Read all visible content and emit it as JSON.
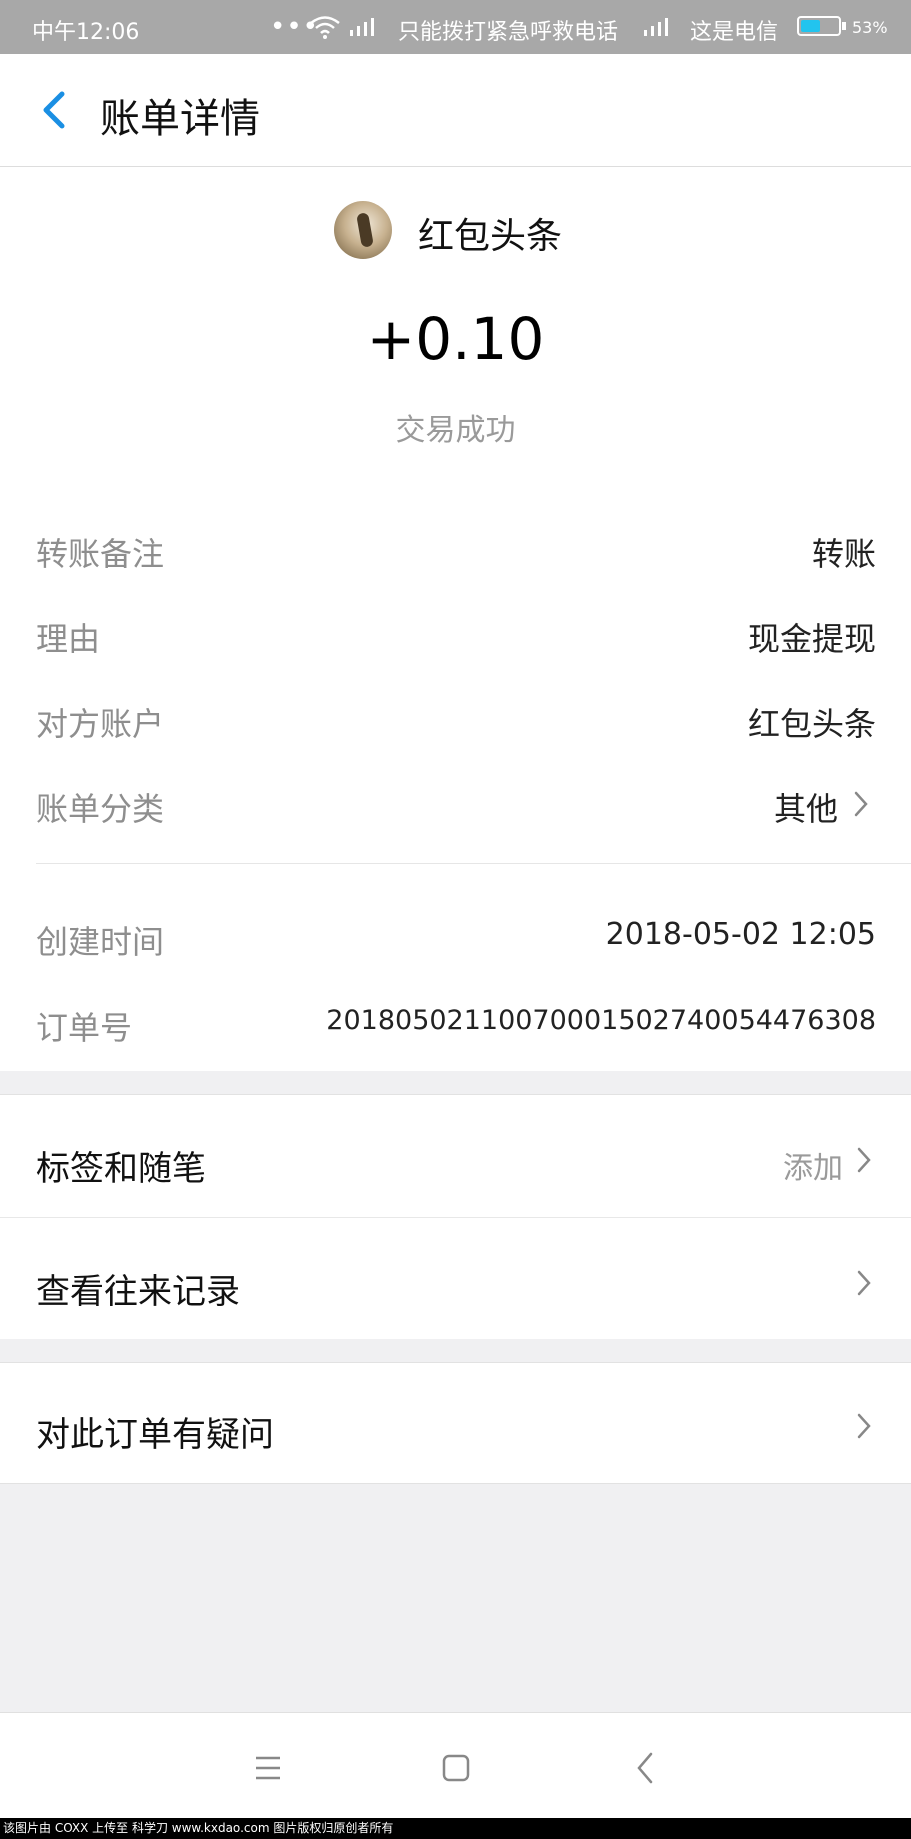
{
  "status_bar": {
    "time": "中午12:06",
    "carrier_note": "只能拨打紧急呼救电话",
    "carrier": "这是电信",
    "battery": "53%",
    "battery_level": 0.53,
    "icons": [
      "dots-icon",
      "wifi-icon",
      "signal-icon"
    ]
  },
  "header": {
    "title": "账单详情",
    "back_icon": "chevron-left-icon"
  },
  "summary": {
    "merchant_name": "红包头条",
    "amount": "+0.10",
    "status": "交易成功"
  },
  "details": [
    {
      "label": "转账备注",
      "value": "转账"
    },
    {
      "label": "理由",
      "value": "现金提现"
    },
    {
      "label": "对方账户",
      "value": "红包头条"
    },
    {
      "label": "账单分类",
      "value": "其他"
    }
  ],
  "meta": [
    {
      "label": "创建时间",
      "value": "2018-05-02 12:05"
    },
    {
      "label": "订单号",
      "value": "20180502110070001502740054476308"
    }
  ],
  "actions": {
    "tags": {
      "label": "标签和随笔",
      "hint": "添加"
    },
    "history": {
      "label": "查看往来记录"
    },
    "dispute": {
      "label": "对此订单有疑问"
    }
  },
  "nav": [
    "menu-icon",
    "home-icon",
    "back-icon"
  ],
  "footer": "该图片由 COXX 上传至 科学刀 www.kxdao.com 图片版权归原创者所有",
  "colors": {
    "accent": "#1a8fe3",
    "battery": "#22c4ee"
  }
}
